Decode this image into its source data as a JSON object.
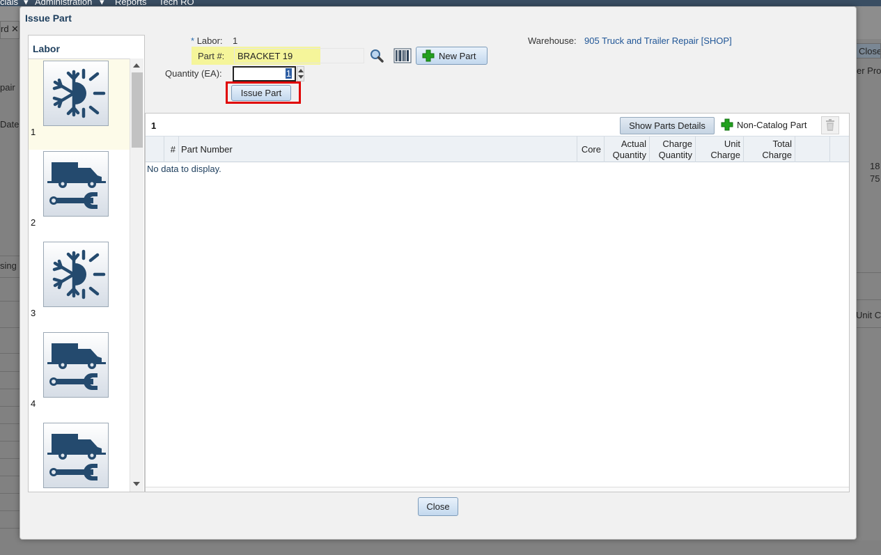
{
  "background": {
    "menu": [
      "cials",
      "Administration",
      "Reports",
      "Tech RO"
    ],
    "tab_fragment": "rd",
    "left_fragments": [
      "pair",
      "Date:",
      "sing"
    ],
    "right_close": "Close",
    "right_fragments": [
      "er Prod",
      "18",
      "75",
      "Unit C"
    ]
  },
  "dialog": {
    "title": "Issue Part",
    "labor_panel": {
      "title": "Labor",
      "items": [
        {
          "num": "1",
          "icon": "ac-climate-icon"
        },
        {
          "num": "2",
          "icon": "truck-wrench-icon"
        },
        {
          "num": "3",
          "icon": "ac-climate-icon"
        },
        {
          "num": "4",
          "icon": "truck-wrench-icon"
        },
        {
          "num": "",
          "icon": "truck-wrench-icon"
        }
      ]
    },
    "form": {
      "labor_label": "Labor:",
      "labor_required_mark": "*",
      "labor_value": "1",
      "part_label": "Part #:",
      "part_value": "BRACKET 19",
      "new_part_label": "New Part",
      "quantity_label": "Quantity (EA):",
      "quantity_value": "1",
      "issue_button": "Issue Part",
      "warehouse_label": "Warehouse:",
      "warehouse_value": "905 Truck and Trailer Repair [SHOP]"
    },
    "grid": {
      "labor_number": "1",
      "show_details_button": "Show Parts Details",
      "non_catalog_label": "Non-Catalog Part",
      "columns": {
        "num": "#",
        "part_number": "Part Number",
        "core": "Core",
        "actual_1": "Actual",
        "actual_2": "Quantity",
        "charge_1": "Charge",
        "charge_2": "Quantity",
        "unit_1": "Unit",
        "unit_2": "Charge",
        "total_1": "Total",
        "total_2": "Charge"
      },
      "empty_message": "No data to display."
    },
    "close_button": "Close"
  },
  "colors": {
    "accent_blue": "#1c3d5c",
    "link_blue": "#1f5596",
    "highlight_yellow": "#f5f59a",
    "issue_box_red": "#e00000",
    "green_plus": "#22a01e"
  }
}
